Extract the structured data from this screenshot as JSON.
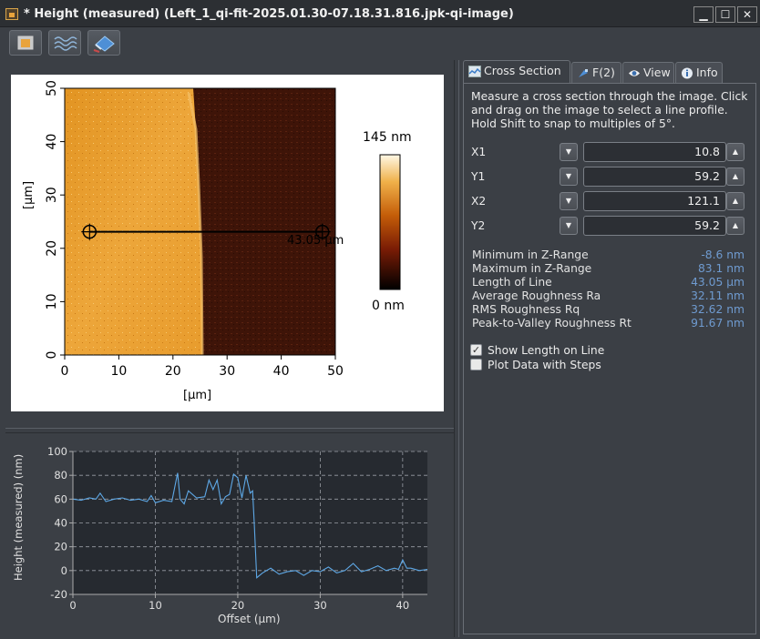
{
  "window": {
    "title": "* Height (measured) (Left_1_qi-fit-2025.01.30-07.18.31.816.jpk-qi-image)",
    "buttons": {
      "minimize": "▁",
      "maximize": "☐",
      "close": "✕"
    }
  },
  "toolbar": {
    "buttons": [
      "square-selection-icon",
      "waves-icon",
      "eraser-icon"
    ]
  },
  "image_view": {
    "y_axis_label": "[µm]",
    "x_axis_label": "[µm]",
    "x_ticks": [
      "0",
      "10",
      "20",
      "30",
      "40",
      "50"
    ],
    "y_ticks": [
      "0",
      "10",
      "20",
      "30",
      "40",
      "50"
    ],
    "colorbar_max": "145 nm",
    "colorbar_min": "0 nm",
    "line_label": "43.05 µm",
    "line": {
      "x1": 4.6,
      "y1": 23.1,
      "x2": 47.6,
      "y2": 23.1
    }
  },
  "tabs": [
    {
      "label": "Cross Section",
      "icon": "cross-section-icon",
      "active": true
    },
    {
      "label": "F(2)",
      "icon": "tip-icon",
      "active": false
    },
    {
      "label": "View",
      "icon": "eye-icon",
      "active": false
    },
    {
      "label": "Info",
      "icon": "info-icon",
      "active": false
    }
  ],
  "cross_section": {
    "description": "Measure a cross section through the image. Click and drag on the image to select a line profile. Hold Shift to snap to multiples of 5°.",
    "fields": [
      {
        "label": "X1",
        "value": "10.8"
      },
      {
        "label": "Y1",
        "value": "59.2"
      },
      {
        "label": "X2",
        "value": "121.1"
      },
      {
        "label": "Y2",
        "value": "59.2"
      }
    ],
    "stats": [
      {
        "label": "Minimum in Z-Range",
        "value": "-8.6 nm"
      },
      {
        "label": "Maximum in Z-Range",
        "value": "83.1 nm"
      },
      {
        "label": "Length of Line",
        "value": "43.05 µm"
      },
      {
        "label": "Average Roughness Ra",
        "value": "32.11 nm"
      },
      {
        "label": "RMS Roughness Rq",
        "value": "32.62 nm"
      },
      {
        "label": "Peak-to-Valley Roughness Rt",
        "value": "91.67 nm"
      }
    ],
    "checkboxes": [
      {
        "label": "Show Length on Line",
        "checked": true
      },
      {
        "label": "Plot Data with Steps",
        "checked": false
      }
    ]
  },
  "colors": {
    "accent_value": "#6f9bd0",
    "profile_line": "#5ea8e6",
    "plot_bg": "#262a30"
  },
  "chart_data": {
    "type": "line",
    "xlabel": "Offset (µm)",
    "ylabel": "Height (measured) (nm)",
    "xlim": [
      0,
      43
    ],
    "ylim": [
      -20,
      100
    ],
    "x_ticks": [
      "0",
      "10",
      "20",
      "30",
      "40"
    ],
    "y_ticks": [
      "-20",
      "0",
      "20",
      "40",
      "60",
      "80",
      "100"
    ],
    "grid": true,
    "series": [
      {
        "x": [
          0,
          1,
          2,
          2.8,
          3.3,
          4,
          5,
          6,
          7,
          8,
          9,
          9.5,
          10,
          11,
          12,
          12.7,
          13,
          13.5,
          14,
          15,
          16,
          16.5,
          17,
          17.5,
          18,
          18.5,
          19,
          19.5,
          20,
          20.5,
          21,
          21.5,
          21.8,
          22,
          22.3,
          23,
          24,
          25,
          26,
          27,
          28,
          29,
          30,
          31,
          32,
          33,
          34,
          35,
          36,
          37,
          38,
          39,
          39.5,
          40,
          40.5,
          41,
          42,
          43
        ],
        "y": [
          60,
          59,
          61,
          60,
          65,
          58,
          60,
          61,
          59,
          60,
          58,
          63,
          57,
          59,
          58,
          82,
          60,
          56,
          67,
          61,
          62,
          76,
          68,
          76,
          56,
          62,
          64,
          81,
          78,
          61,
          80,
          65,
          67,
          40,
          -6,
          -2,
          2,
          -3,
          -1,
          0,
          -4,
          0,
          -1,
          3,
          -2,
          0,
          6,
          -1,
          1,
          4,
          0,
          2,
          1,
          9,
          2,
          2,
          0,
          1
        ]
      }
    ]
  }
}
